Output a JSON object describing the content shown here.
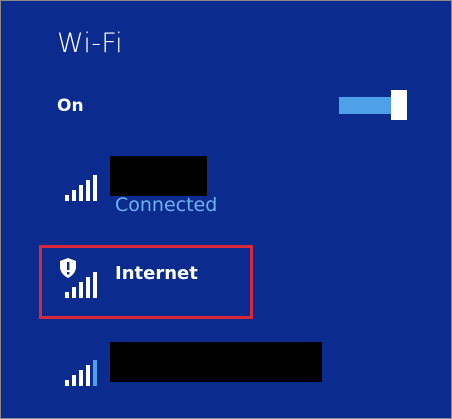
{
  "panel": {
    "title": "Wi-Fi",
    "toggle_label": "On",
    "toggle_state": "on",
    "accent_color": "#4ea0e8",
    "background_color": "#0b2b8f"
  },
  "networks": [
    {
      "name": "",
      "name_redacted": true,
      "status": "Connected",
      "icon": "wifi-signal-icon",
      "signal_bars": 5
    },
    {
      "name": "Internet",
      "status": "",
      "icon": "secured-wifi-signal-icon",
      "signal_bars": 5,
      "highlighted": true
    },
    {
      "name": "",
      "name_redacted": true,
      "status": "",
      "icon": "wifi-signal-icon",
      "signal_bars": 4
    }
  ]
}
